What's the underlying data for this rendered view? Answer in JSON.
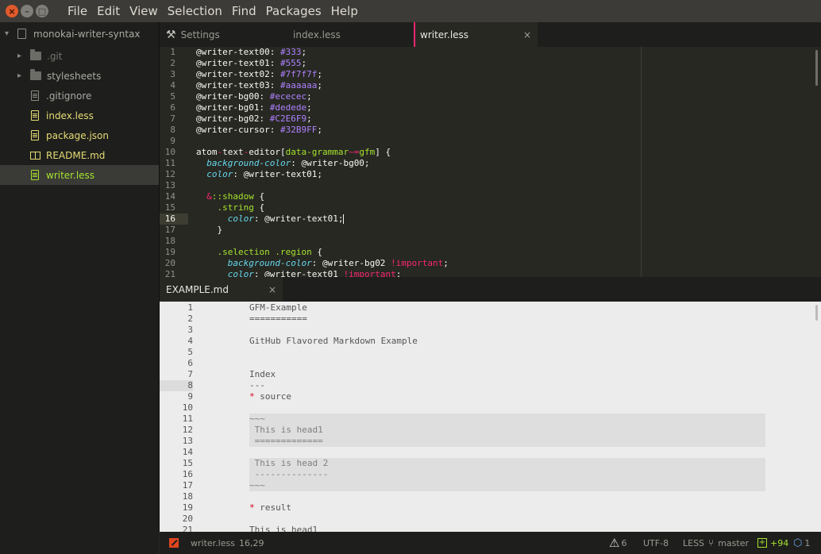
{
  "window": {
    "menu": [
      "File",
      "Edit",
      "View",
      "Selection",
      "Find",
      "Packages",
      "Help"
    ]
  },
  "sidebar": {
    "project": "monokai-writer-syntax",
    "items": [
      {
        "label": ".git",
        "kind": "folder"
      },
      {
        "label": "stylesheets",
        "kind": "folder"
      },
      {
        "label": ".gitignore",
        "kind": "file"
      },
      {
        "label": "index.less",
        "kind": "file-modified"
      },
      {
        "label": "package.json",
        "kind": "file-modified"
      },
      {
        "label": "README.md",
        "kind": "book-modified"
      },
      {
        "label": "writer.less",
        "kind": "file-new",
        "selected": true
      }
    ]
  },
  "tabs": [
    {
      "label": "Settings",
      "icon": "settings-tools-icon"
    },
    {
      "label": "index.less"
    },
    {
      "label": "writer.less",
      "active": true,
      "close": "×"
    }
  ],
  "editor_top": {
    "line_numbers": [
      "1",
      "2",
      "3",
      "4",
      "5",
      "6",
      "7",
      "8",
      "9",
      "10",
      "11",
      "12",
      "13",
      "14",
      "15",
      "16",
      "17",
      "18",
      "19",
      "20",
      "21"
    ],
    "current_line": "16",
    "lines": [
      [
        {
          "t": "@writer-text00: ",
          "c": "c-var"
        },
        {
          "t": "#333",
          "c": "c-num"
        },
        {
          "t": ";",
          "c": "c-var"
        }
      ],
      [
        {
          "t": "@writer-text01: ",
          "c": "c-var"
        },
        {
          "t": "#555",
          "c": "c-num"
        },
        {
          "t": ";",
          "c": "c-var"
        }
      ],
      [
        {
          "t": "@writer-text02: ",
          "c": "c-var"
        },
        {
          "t": "#7f7f7f",
          "c": "c-num"
        },
        {
          "t": ";",
          "c": "c-var"
        }
      ],
      [
        {
          "t": "@writer-text03: ",
          "c": "c-var"
        },
        {
          "t": "#aaaaaa",
          "c": "c-num"
        },
        {
          "t": ";",
          "c": "c-var"
        }
      ],
      [
        {
          "t": "@writer-bg00: ",
          "c": "c-var"
        },
        {
          "t": "#ececec",
          "c": "c-num"
        },
        {
          "t": ";",
          "c": "c-var"
        }
      ],
      [
        {
          "t": "@writer-bg01: ",
          "c": "c-var"
        },
        {
          "t": "#dedede",
          "c": "c-num"
        },
        {
          "t": ";",
          "c": "c-var"
        }
      ],
      [
        {
          "t": "@writer-bg02: ",
          "c": "c-var"
        },
        {
          "t": "#C2E6F9",
          "c": "c-num"
        },
        {
          "t": ";",
          "c": "c-var"
        }
      ],
      [
        {
          "t": "@writer-cursor: ",
          "c": "c-var"
        },
        {
          "t": "#32B9FF",
          "c": "c-num"
        },
        {
          "t": ";",
          "c": "c-var"
        }
      ],
      [],
      [
        {
          "t": "atom",
          "c": "c-var"
        },
        {
          "t": "-",
          "c": "c-tag"
        },
        {
          "t": "text",
          "c": "c-var"
        },
        {
          "t": "-",
          "c": "c-tag"
        },
        {
          "t": "editor[",
          "c": "c-var"
        },
        {
          "t": "data-grammar",
          "c": "c-attr"
        },
        {
          "t": "~=",
          "c": "c-tag"
        },
        {
          "t": "gfm",
          "c": "c-attr"
        },
        {
          "t": "] {",
          "c": "c-var"
        }
      ],
      [
        {
          "t": "  ",
          "c": "c-var"
        },
        {
          "t": "background-color",
          "c": "c-prop"
        },
        {
          "t": ": @writer-bg00;",
          "c": "c-var"
        }
      ],
      [
        {
          "t": "  ",
          "c": "c-var"
        },
        {
          "t": "color",
          "c": "c-prop"
        },
        {
          "t": ": @writer-text01;",
          "c": "c-var"
        }
      ],
      [],
      [
        {
          "t": "  ",
          "c": "c-var"
        },
        {
          "t": "&",
          "c": "c-amp"
        },
        {
          "t": "::shadow",
          "c": "c-cls"
        },
        {
          "t": " {",
          "c": "c-var"
        }
      ],
      [
        {
          "t": "    ",
          "c": "c-var"
        },
        {
          "t": ".string",
          "c": "c-cls"
        },
        {
          "t": " {",
          "c": "c-var"
        }
      ],
      [
        {
          "t": "      ",
          "c": "c-var"
        },
        {
          "t": "color",
          "c": "c-prop"
        },
        {
          "t": ": @writer-text01;",
          "c": "c-var"
        }
      ],
      [
        {
          "t": "    }",
          "c": "c-var"
        }
      ],
      [],
      [
        {
          "t": "    ",
          "c": "c-var"
        },
        {
          "t": ".selection",
          "c": "c-cls"
        },
        {
          "t": " ",
          "c": "c-var"
        },
        {
          "t": ".region",
          "c": "c-cls"
        },
        {
          "t": " {",
          "c": "c-var"
        }
      ],
      [
        {
          "t": "      ",
          "c": "c-var"
        },
        {
          "t": "background-color",
          "c": "c-prop"
        },
        {
          "t": ": @writer-bg02 ",
          "c": "c-var"
        },
        {
          "t": "!important",
          "c": "c-imp"
        },
        {
          "t": ";",
          "c": "c-var"
        }
      ],
      [
        {
          "t": "      ",
          "c": "c-var"
        },
        {
          "t": "color",
          "c": "c-prop"
        },
        {
          "t": ": @writer-text01 ",
          "c": "c-var"
        },
        {
          "t": "!important",
          "c": "c-imp"
        },
        {
          "t": ";",
          "c": "c-var"
        }
      ]
    ]
  },
  "pane_bottom": {
    "tab": "EXAMPLE.md",
    "close": "×"
  },
  "editor_bottom": {
    "line_numbers": [
      "1",
      "2",
      "3",
      "4",
      "5",
      "6",
      "7",
      "8",
      "9",
      "10",
      "11",
      "12",
      "13",
      "14",
      "15",
      "16",
      "17",
      "18",
      "19",
      "20",
      "21"
    ],
    "current_line": "8",
    "lines": [
      [
        {
          "t": "GFM-Example",
          "c": ""
        }
      ],
      [
        {
          "t": "===========",
          "c": ""
        }
      ],
      [],
      [
        {
          "t": "GitHub Flavored Markdown Example",
          "c": ""
        }
      ],
      [],
      [],
      [
        {
          "t": "Index",
          "c": ""
        }
      ],
      [
        {
          "t": "---",
          "c": ""
        }
      ],
      [
        {
          "t": "*",
          "c": "star"
        },
        {
          "t": " source",
          "c": ""
        }
      ],
      [],
      [
        {
          "t": "~~~",
          "c": "dim"
        }
      ],
      [
        {
          "t": " This is head1",
          "c": "dim"
        }
      ],
      [
        {
          "t": " =============",
          "c": "dim"
        }
      ],
      [],
      [
        {
          "t": " This is head 2",
          "c": "dim"
        }
      ],
      [
        {
          "t": " --------------",
          "c": "dim"
        }
      ],
      [
        {
          "t": "~~~",
          "c": "dim"
        }
      ],
      [],
      [
        {
          "t": "*",
          "c": "star"
        },
        {
          "t": " result",
          "c": ""
        }
      ],
      [],
      [
        {
          "t": "This is head1",
          "c": ""
        }
      ]
    ]
  },
  "status": {
    "file": "writer.less",
    "cursor": "16,29",
    "warnings": "6",
    "encoding": "UTF-8",
    "grammar": "LESS",
    "branch": "master",
    "diff": "+94",
    "packages": "1"
  },
  "colors": {
    "accent": "#f92672",
    "editor_bg": "#272822",
    "panel_bg": "#1e1f1c",
    "light_editor_bg": "#ececec"
  }
}
